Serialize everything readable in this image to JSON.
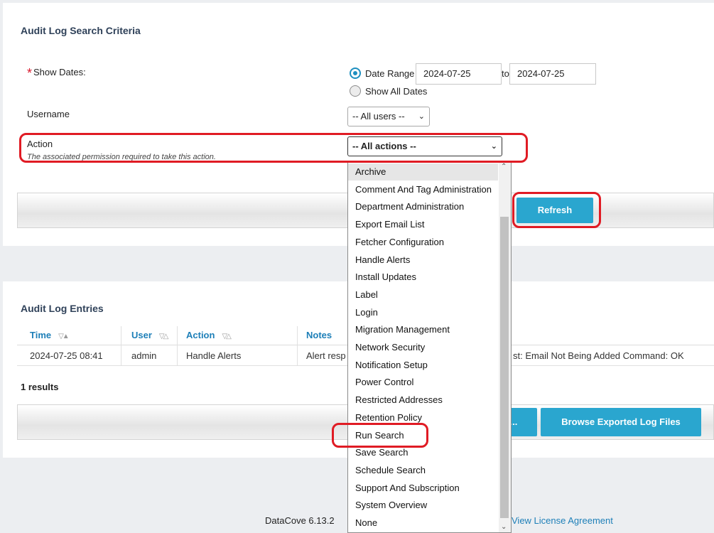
{
  "criteria": {
    "title": "Audit Log Search Criteria",
    "show_dates_label": "Show Dates:",
    "required_mark": "*",
    "date_range_label": "Date Range",
    "date_from": "2024-07-25",
    "to_label": "to",
    "date_to": "2024-07-25",
    "show_all_dates_label": "Show All Dates",
    "username_label": "Username",
    "username_value": "-- All users --",
    "action_label": "Action",
    "action_hint": "The associated permission required to take this action.",
    "action_value": "-- All actions --",
    "refresh_label": "Refresh"
  },
  "dropdown": {
    "options": [
      "Archive",
      "Comment And Tag Administration",
      "Department Administration",
      "Export Email List",
      "Fetcher Configuration",
      "Handle Alerts",
      "Install Updates",
      "Label",
      "Login",
      "Migration Management",
      "Network Security",
      "Notification Setup",
      "Power Control",
      "Restricted Addresses",
      "Retention Policy",
      "Run Search",
      "Save Search",
      "Schedule Search",
      "Support And Subscription",
      "System Overview",
      "None"
    ],
    "selected": "Archive"
  },
  "entries": {
    "title": "Audit Log Entries",
    "columns": [
      "Time",
      "User",
      "Action",
      "Notes"
    ],
    "rows": [
      {
        "time": "2024-07-25 08:41",
        "user": "admin",
        "action": "Handle Alerts",
        "notes_visible_start": "Alert resp",
        "notes_visible_end": "st: Email Not Being Added Command: OK"
      }
    ],
    "results_count": "1 results",
    "export_button_partial": "...",
    "browse_button_label": "Browse Exported Log Files"
  },
  "footer": {
    "version": "DataCove 6.13.2",
    "license_link": "View License Agreement"
  },
  "colors": {
    "accent": "#2aa6cf",
    "link": "#1d7fb8",
    "annotation": "#e01b24"
  }
}
